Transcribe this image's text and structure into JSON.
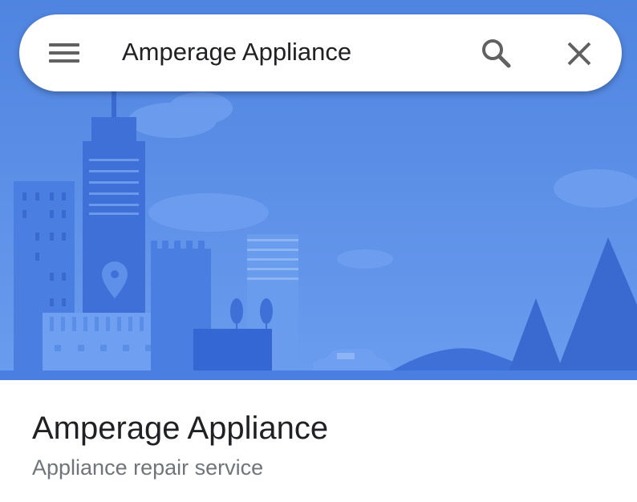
{
  "search": {
    "query": "Amperage Appliance",
    "menu_icon": "hamburger-menu-icon",
    "search_icon": "search-icon",
    "close_icon": "close-icon"
  },
  "hero": {
    "illustration": "city-skyline-placeholder",
    "pin_icon": "location-pin-icon",
    "sky_color": "#5b8ee6",
    "accent_color": "#3d6fd9"
  },
  "place": {
    "name": "Amperage Appliance",
    "category": "Appliance repair service"
  }
}
